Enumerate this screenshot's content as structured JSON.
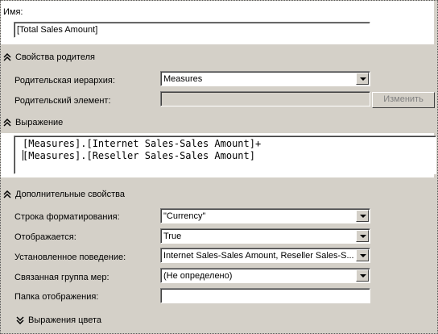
{
  "name_section": {
    "label": "Имя:",
    "value": "[Total Sales Amount]"
  },
  "parent_properties": {
    "title": "Свойства родителя",
    "state_icon": "collapse-up-double-chevron",
    "hierarchy_label": "Родительская иерархия:",
    "hierarchy_value": "Measures",
    "member_label": "Родительский элемент:",
    "member_value": "",
    "change_button": "Изменить"
  },
  "expression": {
    "title": "Выражение",
    "state_icon": "collapse-up-double-chevron",
    "line1": "[Measures].[Internet Sales-Sales Amount]+",
    "line2": "[Measures].[Reseller Sales-Sales Amount]"
  },
  "additional_properties": {
    "title": "Дополнительные свойства",
    "state_icon": "collapse-up-double-chevron",
    "format_label": "Строка форматирования:",
    "format_value": "\"Currency\"",
    "visible_label": "Отображается:",
    "visible_value": "True",
    "behavior_label": "Установленное поведение:",
    "behavior_value": "Internet Sales-Sales Amount, Reseller Sales-S...",
    "group_label": "Связанная группа мер:",
    "group_value": "(Не определено)",
    "folder_label": "Папка отображения:",
    "folder_value": ""
  },
  "color_expressions": {
    "title": "Выражения цвета",
    "state_icon": "expand-down-double-chevron"
  },
  "colors": {
    "panel_gray": "#d4d0c8",
    "field_white": "#ffffff",
    "disabled_text": "#808080"
  }
}
